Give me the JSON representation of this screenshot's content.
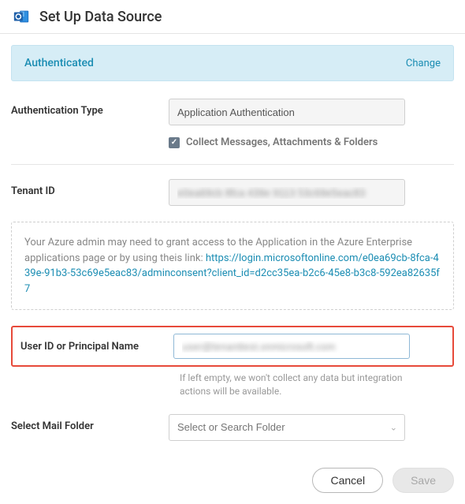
{
  "header": {
    "title": "Set Up Data Source"
  },
  "auth": {
    "status": "Authenticated",
    "change": "Change"
  },
  "fields": {
    "auth_type_label": "Authentication Type",
    "auth_type_value": "Application Authentication",
    "collect_label": "Collect Messages, Attachments & Folders",
    "tenant_label": "Tenant ID",
    "tenant_value": "e0ea69cb 8fca 439e 9113 53c69e5eac83",
    "user_label": "User ID or Principal Name",
    "user_value": "user@tenanttest.onmicrosoft.com",
    "user_helper": "If left empty, we won't collect any data but integration actions will be available.",
    "folder_label": "Select Mail Folder",
    "folder_placeholder": "Select or Search Folder"
  },
  "info": {
    "text": "Your Azure admin may need to grant access to the Application in the Azure Enterprise applications page or by using theis link: ",
    "link": "https://login.microsoftonline.com/e0ea69cb-8fca-439e-91b3-53c69e5eac83/adminconsent?client_id=d2cc35ea-b2c6-45e8-b3c8-592ea82635f7"
  },
  "buttons": {
    "cancel": "Cancel",
    "save": "Save"
  }
}
